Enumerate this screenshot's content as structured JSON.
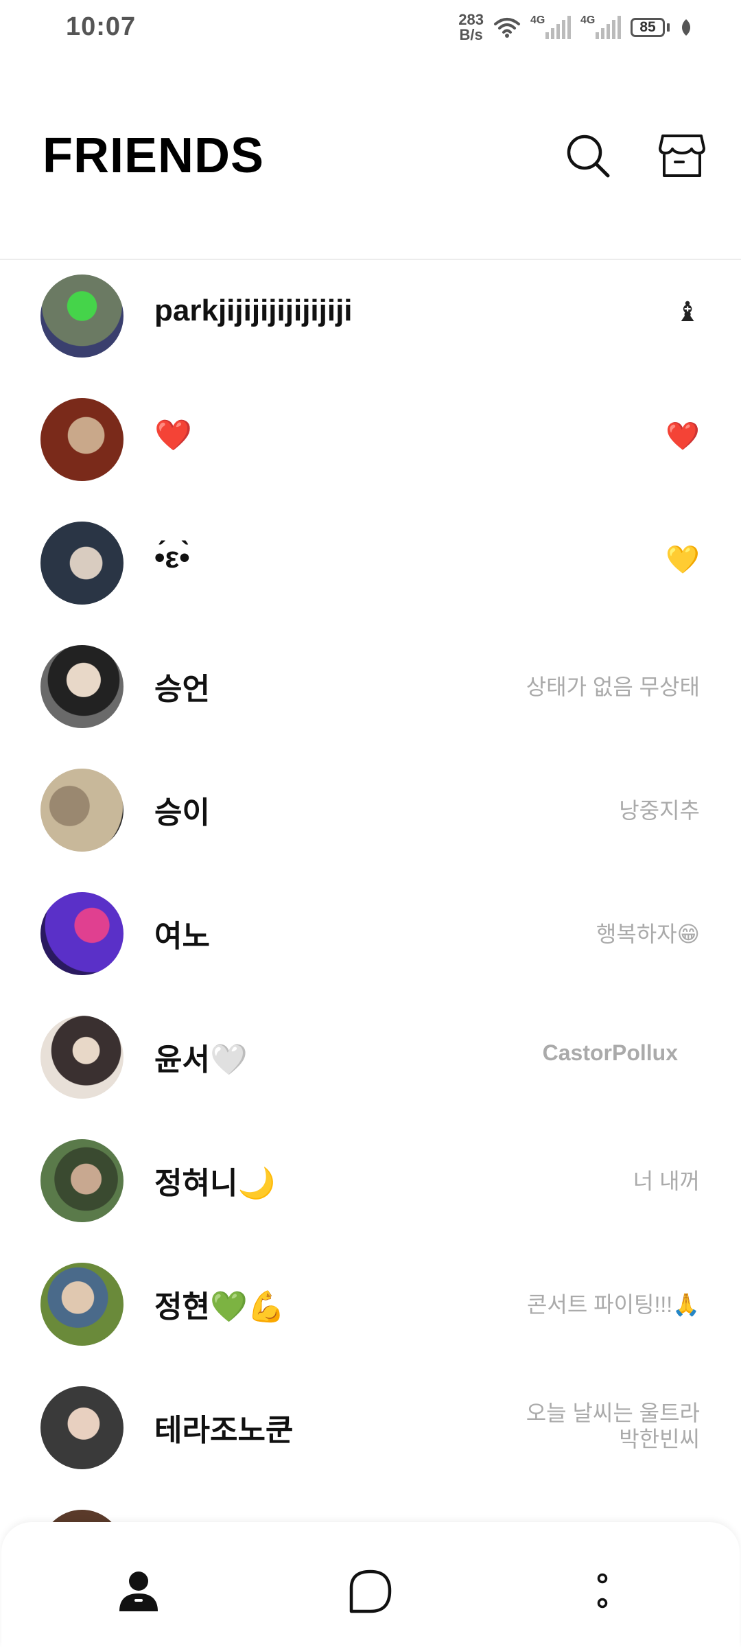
{
  "status_bar": {
    "time": "10:07",
    "net_speed_value": "283",
    "net_speed_unit": "B/s",
    "signal1_label": "4G",
    "signal2_label": "4G",
    "battery": "85"
  },
  "header": {
    "title": "FRIENDS",
    "search_icon": "search-icon",
    "shop_icon": "shop-icon"
  },
  "friends": [
    {
      "name": "parkjijijijijijijiji",
      "status": "♝",
      "status_type": "emoji",
      "avatar_colors": [
        "#6b7a63",
        "#45d44a",
        "#3a3f6e"
      ]
    },
    {
      "name": "❤️",
      "status": "❤️",
      "status_type": "emoji",
      "avatar_colors": [
        "#7a2a1a",
        "#c9a88a",
        "#5a2014"
      ]
    },
    {
      "name": "•́ε•̀",
      "status": "💛",
      "status_type": "emoji",
      "avatar_colors": [
        "#2a3545",
        "#d9ccc0",
        "#1a2530"
      ]
    },
    {
      "name": "승언",
      "status": "상태가 없음 무상태",
      "status_type": "text",
      "avatar_colors": [
        "#4a4a4a",
        "#e8d8c8",
        "#222"
      ]
    },
    {
      "name": "승이",
      "status": "낭중지추",
      "status_type": "text",
      "avatar_colors": [
        "#c8b89a",
        "#9a8870",
        "#2a2a2a"
      ]
    },
    {
      "name": "여노",
      "status": "행복하자😁",
      "status_type": "text",
      "avatar_colors": [
        "#5a30c8",
        "#e04090",
        "#2a1a60"
      ]
    },
    {
      "name": "윤서🤍",
      "status": "CastorPollux",
      "status_type": "bold",
      "avatar_colors": [
        "#e8e0d8",
        "#3a3030",
        "#c8b8a8"
      ]
    },
    {
      "name": "정혀니🌙",
      "status": "너 내꺼",
      "status_type": "text",
      "avatar_colors": [
        "#5a7a4a",
        "#c8a890",
        "#3a4a30"
      ]
    },
    {
      "name": "정현💚💪",
      "status": "콘서트 파이팅!!!🙏",
      "status_type": "text",
      "avatar_colors": [
        "#6a8a3a",
        "#e0c8b0",
        "#4a6a8a"
      ]
    },
    {
      "name": "테라조노쿤",
      "status_line1": "오늘 날씨는 울트라",
      "status_line2": "박한빈씨",
      "status_type": "two-line",
      "avatar_colors": [
        "#3a3a3a",
        "#e8d0c0",
        "#c04040"
      ]
    }
  ],
  "bottom_nav": {
    "friends_icon": "person-icon",
    "chat_icon": "chat-bubble-icon",
    "more_icon": "more-icon"
  }
}
